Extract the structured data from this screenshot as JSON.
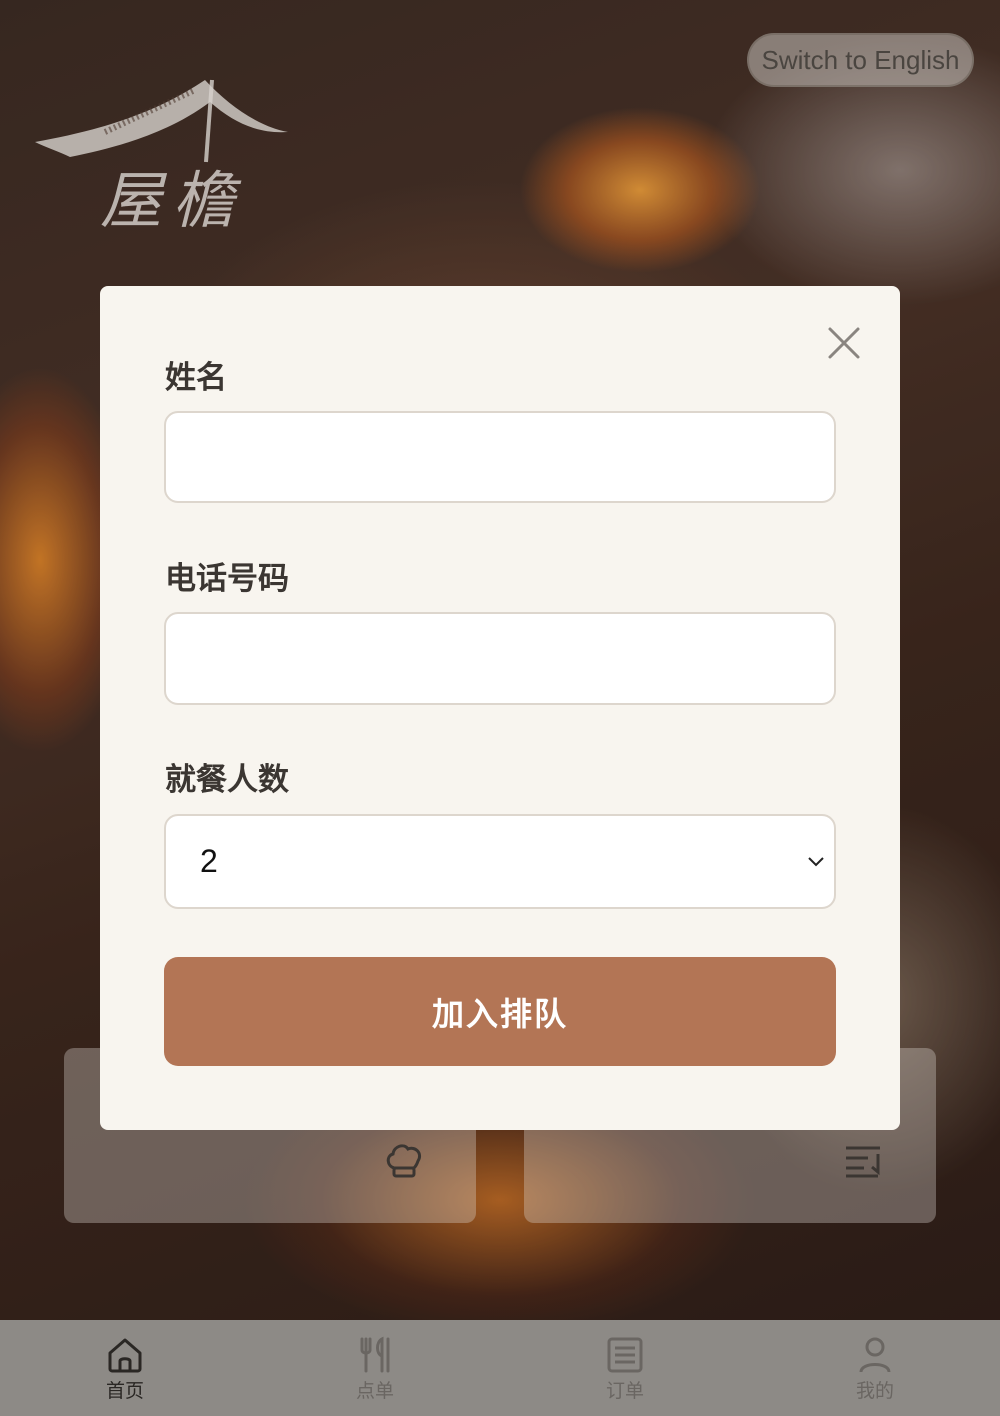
{
  "header": {
    "language_toggle": "Switch to English",
    "logo_text": "屋檐"
  },
  "modal": {
    "name_label": "姓名",
    "name_value": "",
    "phone_label": "电话号码",
    "phone_value": "",
    "party_size_label": "就餐人数",
    "party_size_value": "2",
    "submit_label": "加入排队"
  },
  "cards": [
    {
      "icon": "chef-hat-icon"
    },
    {
      "icon": "queue-list-icon"
    }
  ],
  "bottom_nav": {
    "items": [
      {
        "label": "首页",
        "icon": "home-icon",
        "active": true
      },
      {
        "label": "点单",
        "icon": "utensils-icon",
        "active": false
      },
      {
        "label": "订单",
        "icon": "order-list-icon",
        "active": false
      },
      {
        "label": "我的",
        "icon": "user-icon",
        "active": false
      }
    ]
  },
  "colors": {
    "accent": "#b37555",
    "modal_bg": "#f8f5ef",
    "nav_bg": "#8d8a86"
  }
}
